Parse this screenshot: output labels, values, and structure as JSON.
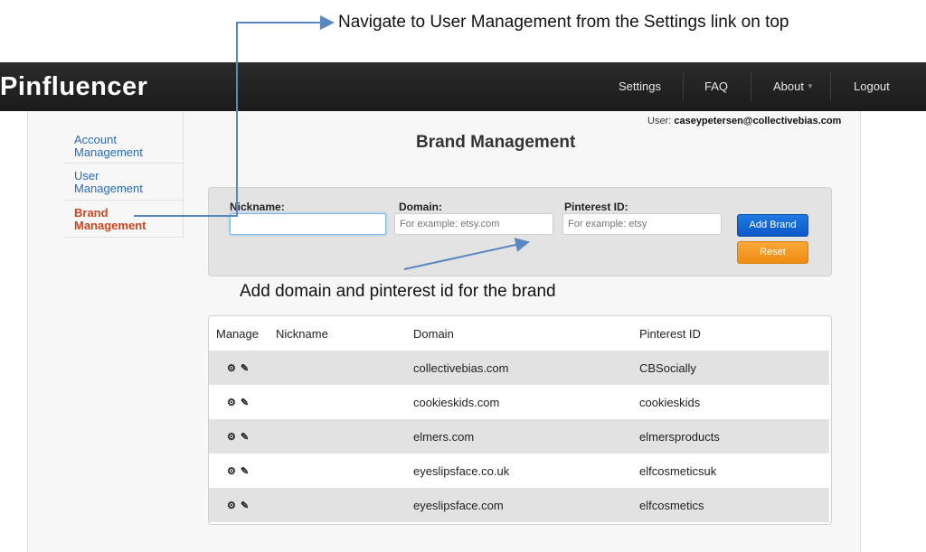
{
  "annotations": {
    "top": "Navigate to User Management from the Settings link on top",
    "middle": "Add domain and pinterest id for the brand"
  },
  "navbar": {
    "logo": "Pinfluencer",
    "items": [
      {
        "label": "Settings"
      },
      {
        "label": "FAQ"
      },
      {
        "label": "About"
      },
      {
        "label": "Logout"
      }
    ]
  },
  "sidebar": {
    "items": [
      {
        "label": "Account Management",
        "active": false
      },
      {
        "label": "User Management",
        "active": false
      },
      {
        "label": "Brand Management",
        "active": true
      }
    ]
  },
  "user": {
    "prefix": "User:",
    "email": "caseypetersen@collectivebias.com"
  },
  "page": {
    "title": "Brand Management"
  },
  "form": {
    "nickname_label": "Nickname:",
    "nickname_value": "",
    "domain_label": "Domain:",
    "domain_placeholder": "For example: etsy.com",
    "pinterest_label": "Pinterest ID:",
    "pinterest_placeholder": "For example: etsy",
    "add_button": "Add Brand",
    "reset_button": "Reset"
  },
  "table": {
    "headers": [
      "Manage",
      "Nickname",
      "Domain",
      "Pinterest ID"
    ],
    "rows": [
      {
        "nickname": "",
        "domain": "collectivebias.com",
        "pinterest_id": "CBSocially"
      },
      {
        "nickname": "",
        "domain": "cookieskids.com",
        "pinterest_id": "cookieskids"
      },
      {
        "nickname": "",
        "domain": "elmers.com",
        "pinterest_id": "elmersproducts"
      },
      {
        "nickname": "",
        "domain": "eyeslipsface.co.uk",
        "pinterest_id": "elfcosmeticsuk"
      },
      {
        "nickname": "",
        "domain": "eyeslipsface.com",
        "pinterest_id": "elfcosmetics"
      }
    ]
  },
  "icons": {
    "manage": [
      "gear-icon",
      "edit-icon"
    ]
  },
  "colors": {
    "navbar": "#1b1b1b",
    "link": "#2a6ab8",
    "active_link": "#d0451b",
    "primary_button": "#0b58c7",
    "reset_button": "#ef8d10",
    "arrow": "#5b87c0"
  }
}
